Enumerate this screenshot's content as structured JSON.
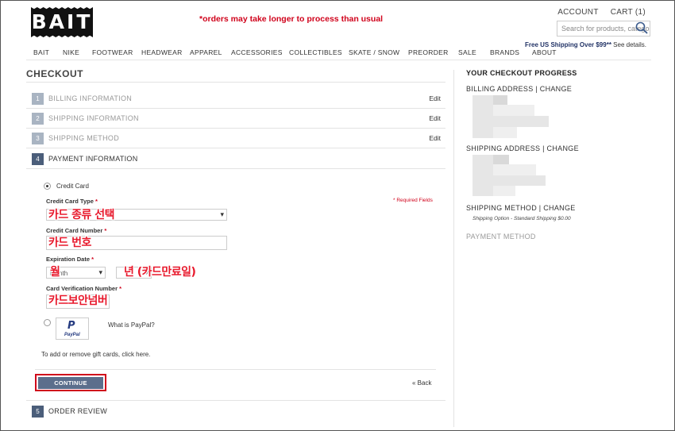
{
  "header": {
    "logo": "BAIT",
    "promo": "*orders may take longer to process than usual",
    "account": "ACCOUNT",
    "cart": "CART (1)",
    "search_placeholder": "Search for products, categories",
    "shipping_note": "Free US Shipping Over $99**",
    "shipping_details": "See details."
  },
  "nav": [
    "BAIT",
    "NIKE",
    "FOOTWEAR",
    "HEADWEAR",
    "APPAREL",
    "ACCESSORIES",
    "COLLECTIBLES",
    "SKATE / SNOW",
    "PREORDER",
    "SALE",
    "BRANDS",
    "ABOUT"
  ],
  "checkout": {
    "title": "CHECKOUT",
    "steps": [
      {
        "num": "1",
        "label": "BILLING INFORMATION",
        "edit": "Edit"
      },
      {
        "num": "2",
        "label": "SHIPPING INFORMATION",
        "edit": "Edit"
      },
      {
        "num": "3",
        "label": "SHIPPING METHOD",
        "edit": "Edit"
      },
      {
        "num": "4",
        "label": "PAYMENT INFORMATION",
        "edit": ""
      },
      {
        "num": "5",
        "label": "ORDER REVIEW",
        "edit": ""
      }
    ]
  },
  "payment": {
    "credit_card_label": "Credit Card",
    "card_type_label": "Credit Card Type",
    "required_note": "* Required Fields",
    "card_number_label": "Credit Card Number",
    "expiration_label": "Expiration Date",
    "month_placeholder": "Month",
    "cvv_label": "Card Verification Number",
    "what_is_paypal": "What is PayPal?",
    "paypal_logo": "PayPal",
    "gift_text": "To add or remove gift cards,",
    "gift_link": "click here.",
    "continue": "CONTINUE",
    "back": "« Back",
    "required_marker": "*"
  },
  "annotations": {
    "card_type": "카드 종류 선택",
    "card_number": "카드 번호",
    "month": "월",
    "year": "년 (카드만료일)",
    "cvv": "카드보안넘버"
  },
  "sidebar": {
    "title": "YOUR CHECKOUT PROGRESS",
    "billing": "BILLING ADDRESS | CHANGE",
    "shipping": "SHIPPING ADDRESS | CHANGE",
    "method": "SHIPPING METHOD | CHANGE",
    "method_detail": "Shipping Option - Standard Shipping $0.00",
    "payment": "PAYMENT METHOD"
  }
}
